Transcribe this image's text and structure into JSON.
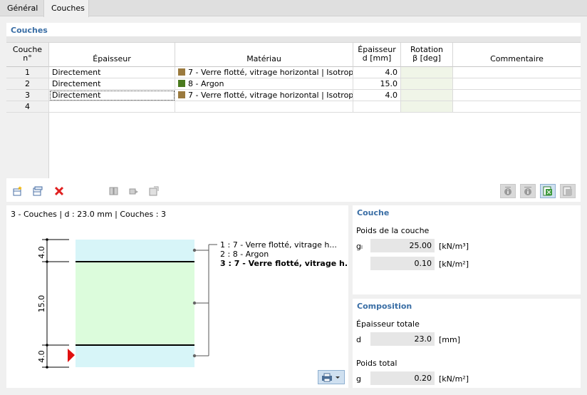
{
  "tabs": [
    {
      "label": "Général"
    },
    {
      "label": "Couches"
    }
  ],
  "layers_panel": {
    "title": "Couches",
    "columns": {
      "no_line1": "Couche",
      "no_line2": "n°",
      "thickness": "Épaisseur",
      "material": "Matériau",
      "d_line1": "Épaisseur",
      "d_line2": "d [mm]",
      "rot_line1": "Rotation",
      "rot_line2": "β [deg]",
      "comment": "Commentaire"
    },
    "rows": [
      {
        "no": "1",
        "type": "Directement",
        "material": "7 - Verre flotté, vitrage horizontal | Isotrop...",
        "color": "#9b7a3e",
        "d": "4.0"
      },
      {
        "no": "2",
        "type": "Directement",
        "material": "8 - Argon",
        "color": "#4a7a1e",
        "d": "15.0"
      },
      {
        "no": "3",
        "type": "Directement",
        "material": "7 - Verre flotté, vitrage horizontal | Isotrop...",
        "color": "#9b7a3e",
        "d": "4.0"
      },
      {
        "no": "4",
        "type": "",
        "material": "",
        "color": "",
        "d": ""
      }
    ]
  },
  "diagram": {
    "title": "3 - Couches | d : 23.0 mm | Couches : 3",
    "dims": [
      "4.0",
      "15.0",
      "4.0"
    ],
    "legend": [
      "1 : 7 - Verre flotté, vitrage h...",
      "2 : 8 - Argon",
      "3 : 7 - Verre flotté, vitrage h..."
    ]
  },
  "couche_panel": {
    "title": "Couche",
    "section": "Poids de la couche",
    "symbol": "gₗ",
    "value1": "25.00",
    "unit1": "[kN/m³]",
    "value2": "0.10",
    "unit2": "[kN/m²]"
  },
  "composition_panel": {
    "title": "Composition",
    "thickness_label": "Épaisseur totale",
    "d_symbol": "d",
    "d_value": "23.0",
    "d_unit": "[mm]",
    "weight_label": "Poids total",
    "g_symbol": "g",
    "g_value": "0.20",
    "g_unit": "[kN/m²]"
  },
  "icons": {
    "insert_row": "insert-row-icon",
    "add_row": "add-row-icon",
    "delete": "delete-icon",
    "print": "print-icon"
  }
}
